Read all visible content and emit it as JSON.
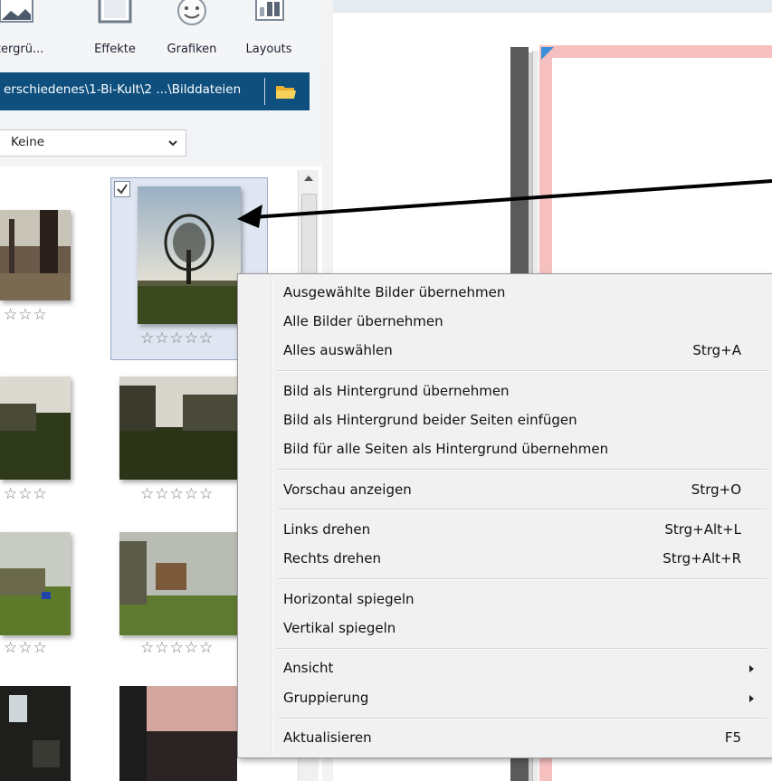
{
  "toolbar": {
    "items": [
      {
        "label": "ntergrü...",
        "icon": "background-icon"
      },
      {
        "label": "Effekte",
        "icon": "effects-icon"
      },
      {
        "label": "Grafiken",
        "icon": "smiley-icon"
      },
      {
        "label": "Layouts",
        "icon": "layouts-icon"
      }
    ]
  },
  "pathbar": {
    "path": "erschiedenes\\1-Bi-Kult\\2 ...\\Bilddateien",
    "folder_icon": "folder-icon"
  },
  "filter": {
    "selected": "Keine"
  },
  "thumbnails": {
    "stars_full": "☆☆☆☆☆",
    "stars_partial": "☆☆☆"
  },
  "context_menu": {
    "items": [
      {
        "label": "Ausgewählte Bilder übernehmen",
        "shortcut": ""
      },
      {
        "label": "Alle Bilder übernehmen",
        "shortcut": ""
      },
      {
        "label": "Alles auswählen",
        "shortcut": "Strg+A"
      },
      {
        "label": "Bild als Hintergrund übernehmen",
        "shortcut": ""
      },
      {
        "label": "Bild als Hintergrund beider Seiten einfügen",
        "shortcut": ""
      },
      {
        "label": "Bild für alle Seiten als Hintergrund übernehmen",
        "shortcut": ""
      },
      {
        "label": "Vorschau anzeigen",
        "shortcut": "Strg+O"
      },
      {
        "label": "Links drehen",
        "shortcut": "Strg+Alt+L"
      },
      {
        "label": "Rechts drehen",
        "shortcut": "Strg+Alt+R"
      },
      {
        "label": "Horizontal spiegeln",
        "shortcut": ""
      },
      {
        "label": "Vertikal spiegeln",
        "shortcut": ""
      },
      {
        "label": "Ansicht",
        "shortcut": "",
        "submenu": true
      },
      {
        "label": "Gruppierung",
        "shortcut": "",
        "submenu": true
      },
      {
        "label": "Aktualisieren",
        "shortcut": "F5"
      }
    ]
  },
  "colors": {
    "path_bar": "#0e4f7e",
    "page_border": "#f6c0c0",
    "selection": "#dfe6f2"
  }
}
